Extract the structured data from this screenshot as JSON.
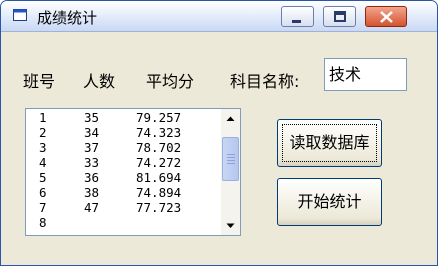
{
  "window": {
    "title": "成绩统计"
  },
  "labels": {
    "class_no": "班号",
    "count": "人数",
    "average": "平均分",
    "subject_name": "科目名称:"
  },
  "subject": {
    "value": "技术"
  },
  "list": {
    "rows": [
      [
        "1",
        "35",
        "79.257"
      ],
      [
        "2",
        "34",
        "74.323"
      ],
      [
        "3",
        "37",
        "78.702"
      ],
      [
        "4",
        "33",
        "74.272"
      ],
      [
        "5",
        "36",
        "81.694"
      ],
      [
        "6",
        "38",
        "74.894"
      ],
      [
        "7",
        "47",
        "77.723"
      ],
      [
        "8",
        "",
        ""
      ]
    ]
  },
  "buttons": {
    "read_db": "读取数据库",
    "start_stats": "开始统计"
  }
}
